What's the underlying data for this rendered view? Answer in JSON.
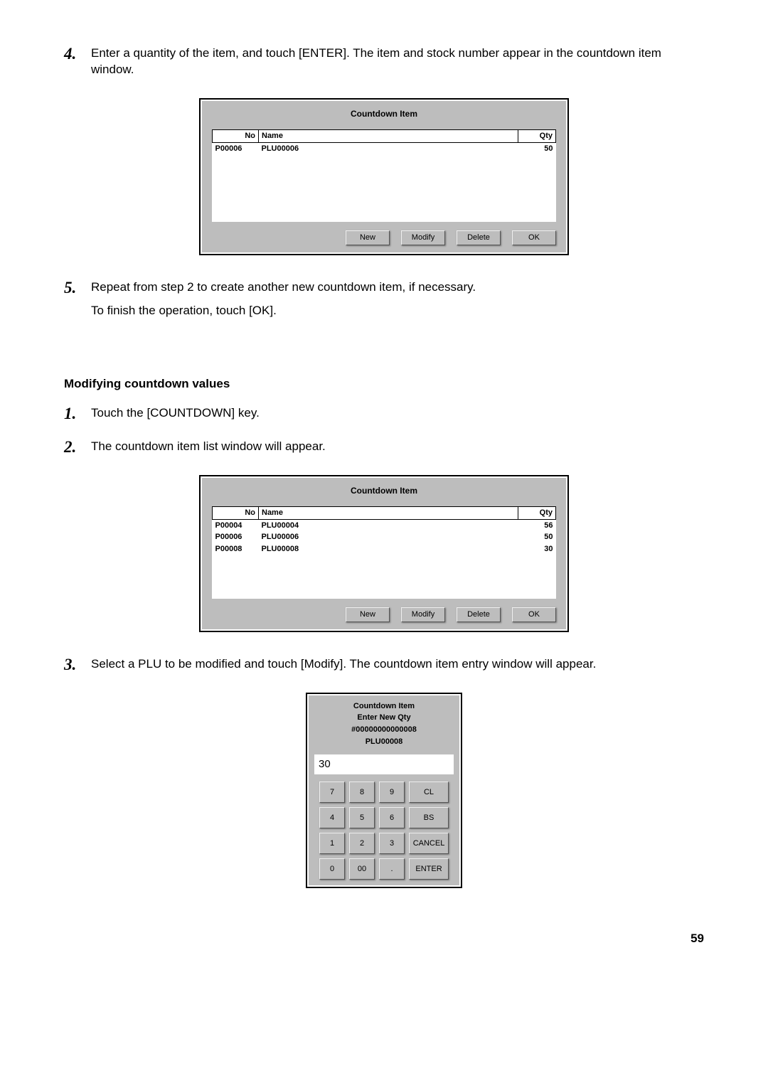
{
  "page_number": "59",
  "steps_a": {
    "s4": {
      "num": "4.",
      "text": "Enter a quantity of the item, and touch [ENTER]. The item and stock number appear in the countdown item window."
    },
    "s5": {
      "num": "5.",
      "line1": "Repeat from step 2 to create another new countdown item, if necessary.",
      "line2": "To finish the operation, touch [OK]."
    }
  },
  "section_title": "Modifying countdown values",
  "steps_b": {
    "s1": {
      "num": "1.",
      "text": "Touch the [COUNTDOWN] key."
    },
    "s2": {
      "num": "2.",
      "text": "The countdown item list window will appear."
    },
    "s3": {
      "num": "3.",
      "text": "Select a PLU to be modified and touch [Modify].  The countdown item entry window will appear."
    }
  },
  "dialog1": {
    "title": "Countdown Item",
    "cols": {
      "no": "No",
      "name": "Name",
      "qty": "Qty"
    },
    "rows": [
      {
        "no": "P00006",
        "name": "PLU00006",
        "qty": "50"
      }
    ],
    "buttons": {
      "new": "New",
      "modify": "Modify",
      "delete": "Delete",
      "ok": "OK"
    }
  },
  "dialog2": {
    "title": "Countdown Item",
    "cols": {
      "no": "No",
      "name": "Name",
      "qty": "Qty"
    },
    "rows": [
      {
        "no": "P00004",
        "name": "PLU00004",
        "qty": "56"
      },
      {
        "no": "P00006",
        "name": "PLU00006",
        "qty": "50"
      },
      {
        "no": "P00008",
        "name": "PLU00008",
        "qty": "30"
      }
    ],
    "buttons": {
      "new": "New",
      "modify": "Modify",
      "delete": "Delete",
      "ok": "OK"
    }
  },
  "keypad": {
    "title": "Countdown Item",
    "sub1": "Enter New Qty",
    "sub2": "#00000000000008",
    "sub3": "PLU00008",
    "display": "30",
    "keys": {
      "k7": "7",
      "k8": "8",
      "k9": "9",
      "cl": "CL",
      "k4": "4",
      "k5": "5",
      "k6": "6",
      "bs": "BS",
      "k1": "1",
      "k2": "2",
      "k3": "3",
      "cancel": "CANCEL",
      "k0": "0",
      "k00": "00",
      "kdot": ".",
      "enter": "ENTER"
    }
  }
}
